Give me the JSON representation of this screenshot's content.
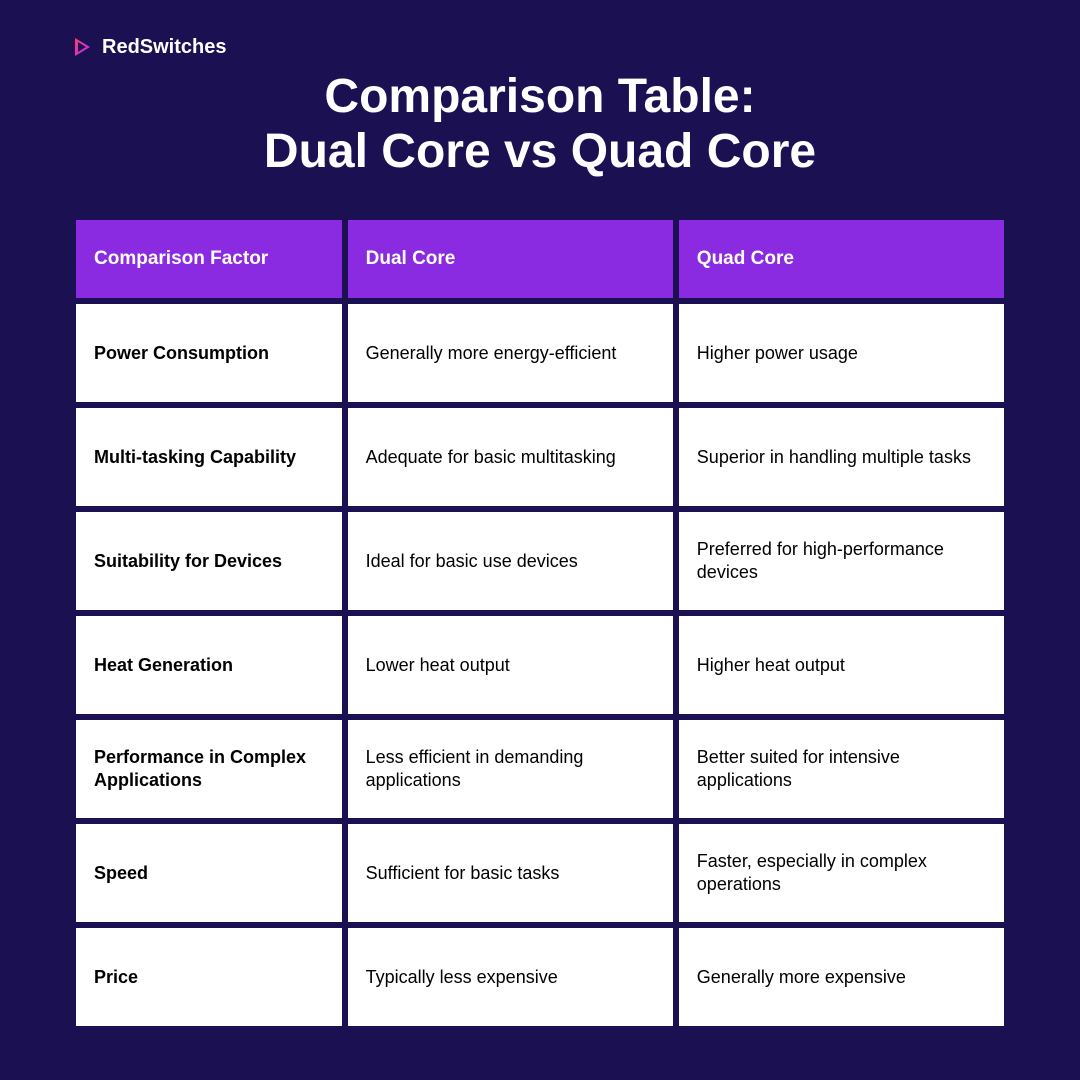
{
  "brand": "RedSwitches",
  "title_line1": "Comparison Table:",
  "title_line2": "Dual Core vs Quad Core",
  "headers": {
    "factor": "Comparison Factor",
    "dual": "Dual Core",
    "quad": "Quad Core"
  },
  "rows": [
    {
      "factor": "Power Consumption",
      "dual": "Generally more energy-efficient",
      "quad": "Higher power usage"
    },
    {
      "factor": "Multi-tasking Capability",
      "dual": "Adequate for basic multitasking",
      "quad": "Superior in handling multiple tasks"
    },
    {
      "factor": "Suitability for Devices",
      "dual": "Ideal for basic use devices",
      "quad": "Preferred for high-performance devices"
    },
    {
      "factor": "Heat Generation",
      "dual": "Lower heat output",
      "quad": "Higher heat output"
    },
    {
      "factor": "Performance in Complex Applications",
      "dual": "Less efficient in demanding applications",
      "quad": "Better suited for intensive applications"
    },
    {
      "factor": "Speed",
      "dual": "Sufficient for basic tasks",
      "quad": "Faster, especially in complex operations"
    },
    {
      "factor": "Price",
      "dual": "Typically less expensive",
      "quad": "Generally more expensive"
    }
  ]
}
